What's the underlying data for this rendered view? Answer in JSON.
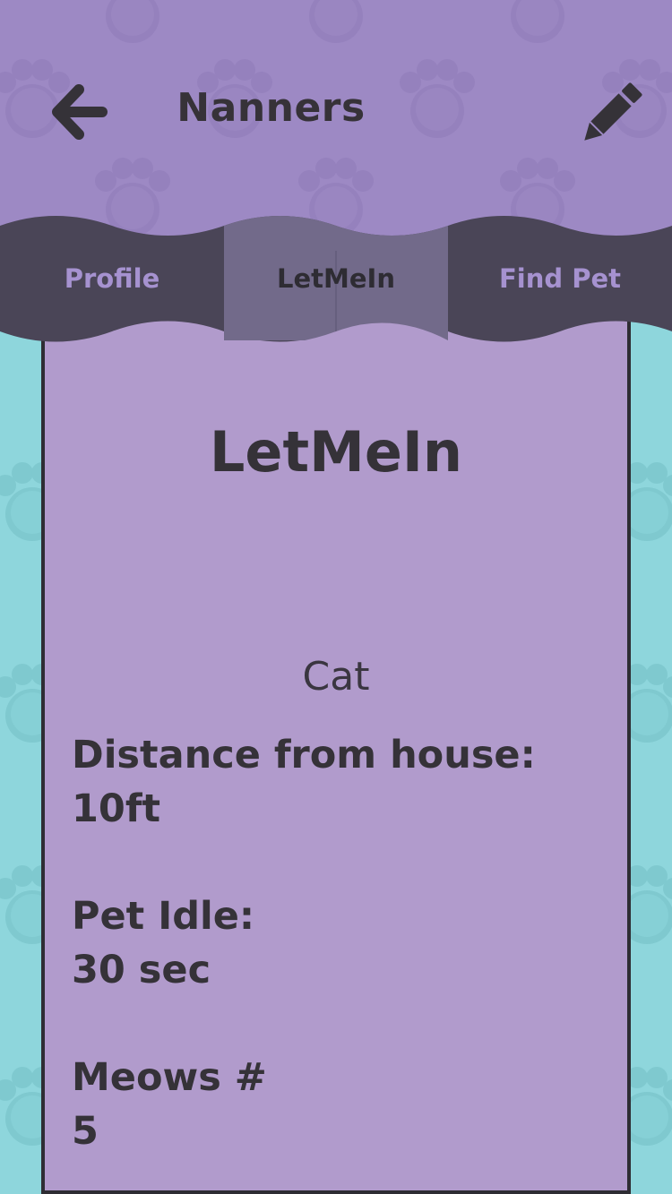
{
  "header": {
    "title": "Nanners",
    "back_icon": "arrow-left-icon",
    "edit_icon": "pencil-icon"
  },
  "tabs": [
    {
      "label": "Profile",
      "active": false
    },
    {
      "label": "LetMeIn",
      "active": true
    },
    {
      "label": "Find Pet",
      "active": false
    }
  ],
  "card": {
    "title": "LetMeIn",
    "pet_type": "Cat",
    "stats": [
      {
        "label": "Distance from house:",
        "value": "10ft"
      },
      {
        "label": "Pet Idle:",
        "value": "30 sec"
      },
      {
        "label": "Meows #",
        "value": "5"
      }
    ]
  },
  "colors": {
    "header_purple": "#9d89c4",
    "tab_bar": "#4a4557",
    "tab_active": "#726a8a",
    "card": "#b19bcc",
    "background_teal": "#8ed6dc",
    "text_dark": "#353238"
  }
}
